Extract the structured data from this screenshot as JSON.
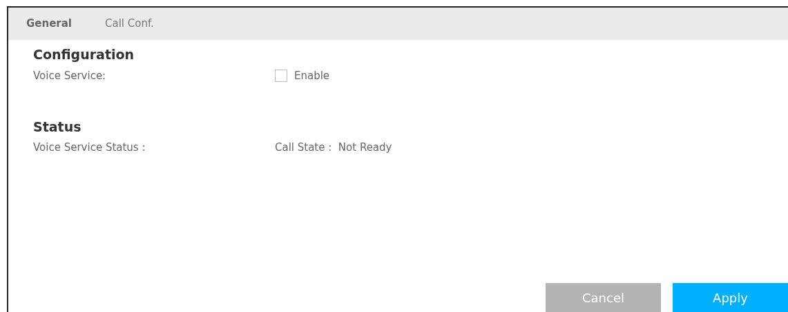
{
  "tabs": [
    {
      "label": "General",
      "selected": true
    },
    {
      "label": "Call Conf.",
      "selected": false
    }
  ],
  "configuration": {
    "title": "Configuration",
    "rows": [
      {
        "label": "Voice Service:",
        "checkbox": {
          "label": "Enable",
          "checked": false
        }
      }
    ]
  },
  "status": {
    "title": "Status",
    "rows": [
      {
        "label": "Voice Service Status :",
        "value": "Call State :  Not Ready"
      }
    ]
  },
  "buttons": [
    {
      "label": "Cancel",
      "kind": "secondary"
    },
    {
      "label": "Apply",
      "kind": "primary"
    }
  ]
}
